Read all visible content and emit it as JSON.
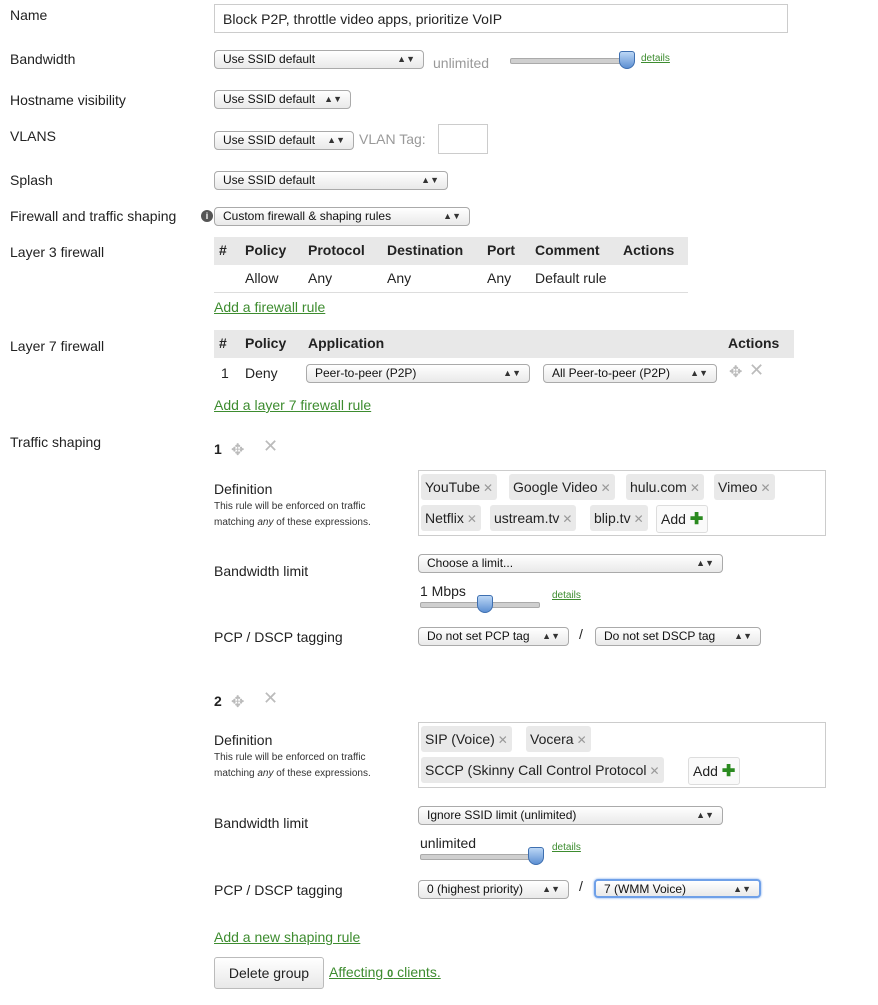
{
  "labels": {
    "name": "Name",
    "bandwidth": "Bandwidth",
    "hostname": "Hostname visibility",
    "vlans": "VLANS",
    "splash": "Splash",
    "firewall": "Firewall and traffic shaping",
    "l3": "Layer 3 firewall",
    "l7": "Layer 7 firewall",
    "traffic": "Traffic shaping"
  },
  "name_value": "Block P2P, throttle video apps, prioritize VoIP",
  "bandwidth": {
    "select": "Use SSID default",
    "value_text": "unlimited",
    "details": "details",
    "level": 1.0
  },
  "hostname_select": "Use SSID default",
  "vlans": {
    "select": "Use SSID default",
    "tag_label": "VLAN Tag:",
    "tag_value": ""
  },
  "splash_select": "Use SSID default",
  "firewall_select": "Custom firewall & shaping rules",
  "l3": {
    "headers": [
      "#",
      "Policy",
      "Protocol",
      "Destination",
      "Port",
      "Comment",
      "Actions"
    ],
    "row": {
      "num": "",
      "policy": "Allow",
      "protocol": "Any",
      "destination": "Any",
      "port": "Any",
      "comment": "Default rule"
    },
    "add_link": "Add a firewall rule"
  },
  "l7": {
    "headers": [
      "#",
      "Policy",
      "Application",
      "Actions"
    ],
    "row": {
      "num": "1",
      "policy": "Deny",
      "app": "Peer-to-peer (P2P)",
      "app_detail": "All Peer-to-peer (P2P)"
    },
    "add_link": "Add a layer 7 firewall rule"
  },
  "rules": [
    {
      "num": "1",
      "definition_label": "Definition",
      "help1": "This rule will be enforced on traffic",
      "help2a": "matching ",
      "help2b": "any",
      "help2c": " of these expressions.",
      "tags": [
        "YouTube",
        "Google Video",
        "hulu.com",
        "Vimeo",
        "Netflix",
        "ustream.tv",
        "blip.tv"
      ],
      "add_label": "Add",
      "bw_label": "Bandwidth limit",
      "bw_select": "Choose a limit...",
      "bw_value": "1 Mbps",
      "bw_level": 0.66,
      "details": "details",
      "pcp_label": "PCP / DSCP tagging",
      "pcp": "Do not set PCP tag",
      "dscp": "Do not set DSCP tag"
    },
    {
      "num": "2",
      "definition_label": "Definition",
      "help1": "This rule will be enforced on traffic",
      "help2a": "matching ",
      "help2b": "any",
      "help2c": " of these expressions.",
      "tags": [
        "SIP (Voice)",
        "Vocera",
        "SCCP (Skinny Call Control Protocol"
      ],
      "add_label": "Add",
      "bw_label": "Bandwidth limit",
      "bw_select": "Ignore SSID limit (unlimited)",
      "bw_value": "unlimited",
      "bw_level": 1.0,
      "details": "details",
      "pcp_label": "PCP / DSCP tagging",
      "pcp": "0 (highest priority)",
      "dscp": "7 (WMM Voice)"
    }
  ],
  "slash": "/",
  "add_shaping_link": "Add a new shaping rule",
  "delete_button": "Delete group",
  "affecting": {
    "pre": "Affecting ",
    "count": "0",
    "post": " clients."
  },
  "icons": {
    "move": "move-icon",
    "delete": "close-icon",
    "info": "info-icon"
  },
  "colors": {
    "link": "#3d8c2f",
    "table_header": "#e8e8e8",
    "tag_bg": "#e9e9e9"
  }
}
